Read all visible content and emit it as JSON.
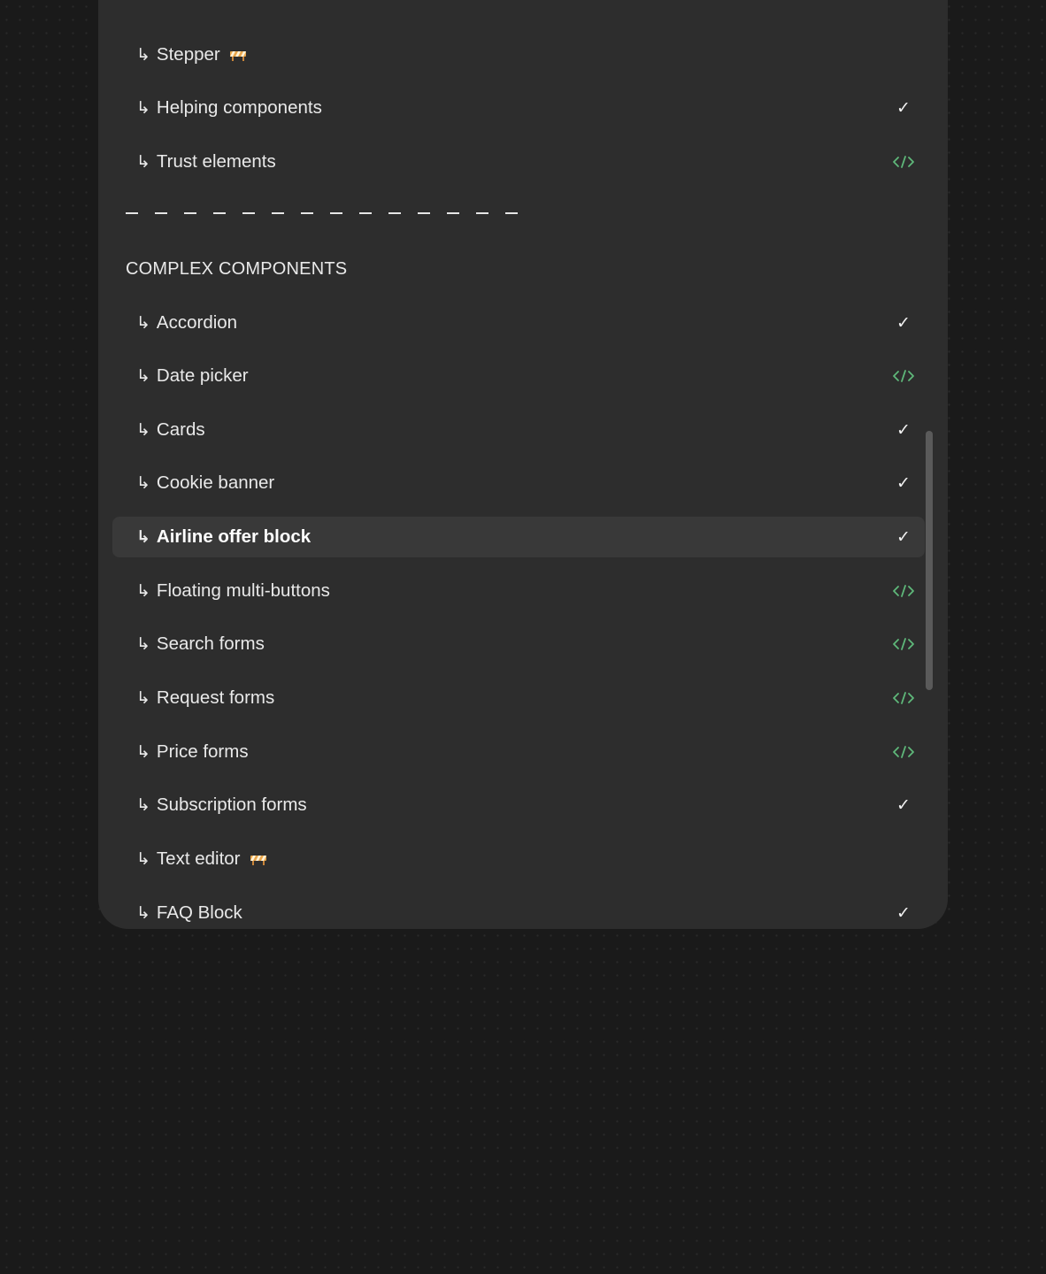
{
  "menu": {
    "top_items": [
      {
        "label": "Stepper",
        "status": "wip",
        "active": false
      },
      {
        "label": "Helping components",
        "status": "done",
        "active": false
      },
      {
        "label": "Trust elements",
        "status": "code",
        "active": false
      }
    ],
    "section_heading": "COMPLEX COMPONENTS",
    "complex_items": [
      {
        "label": "Accordion",
        "status": "done",
        "active": false
      },
      {
        "label": "Date picker",
        "status": "code",
        "active": false
      },
      {
        "label": "Cards",
        "status": "done",
        "active": false
      },
      {
        "label": "Cookie banner",
        "status": "done",
        "active": false
      },
      {
        "label": "Airline offer block",
        "status": "done",
        "active": true
      },
      {
        "label": "Floating multi-buttons",
        "status": "code",
        "active": false
      },
      {
        "label": "Search forms",
        "status": "code",
        "active": false
      },
      {
        "label": "Request forms",
        "status": "code",
        "active": false
      },
      {
        "label": "Price forms",
        "status": "code",
        "active": false
      },
      {
        "label": "Subscription forms",
        "status": "done",
        "active": false
      },
      {
        "label": "Text editor",
        "status": "wip",
        "active": false
      },
      {
        "label": "FAQ Block",
        "status": "done",
        "active": false
      }
    ]
  },
  "glyphs": {
    "arrow": "↳",
    "check": "✓"
  },
  "icons": {
    "done": "check-icon",
    "code": "code-icon",
    "wip": "construction-barrier-icon"
  },
  "colors": {
    "background": "#1a1a1a",
    "panel": "#2d2d2d",
    "active_row": "#393939",
    "code_icon": "#5fb87a",
    "wip_orange": "#e8a54a",
    "text": "#e9e9e9"
  }
}
